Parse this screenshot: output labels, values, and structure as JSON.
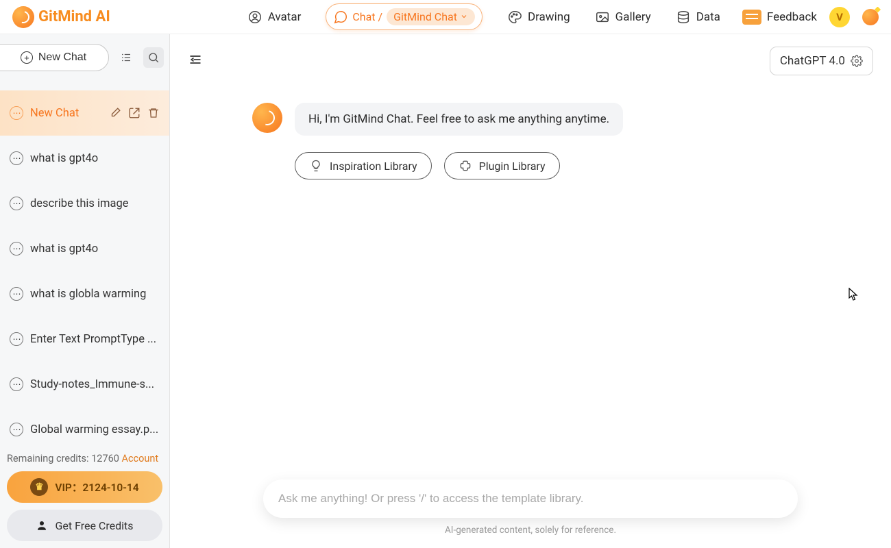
{
  "brand": "GitMind AI",
  "header": {
    "nav": {
      "avatar": "Avatar",
      "chat_prefix": "Chat /",
      "chat_sub": "GitMind Chat",
      "drawing": "Drawing",
      "gallery": "Gallery",
      "data": "Data"
    },
    "feedback": "Feedback",
    "user_initial": "V"
  },
  "sidebar": {
    "new_chat_btn": "New Chat",
    "list": [
      {
        "label": "New Chat",
        "active": true
      },
      {
        "label": "what is gpt4o"
      },
      {
        "label": "describe this image"
      },
      {
        "label": "what is gpt4o"
      },
      {
        "label": "what is globla warming"
      },
      {
        "label": "Enter Text PromptType ..."
      },
      {
        "label": "Study-notes_Immune-s..."
      },
      {
        "label": "Global warming essay.p..."
      }
    ],
    "credits_label": "Remaining credits: ",
    "credits_value": "12760",
    "account_link": "Account",
    "vip_label": "VIP：2124-10-14",
    "free_credits": "Get Free Credits"
  },
  "main": {
    "model": "ChatGPT 4.0",
    "greeting": "Hi, I'm GitMind Chat. Feel free to ask me anything anytime.",
    "chip_inspiration": "Inspiration Library",
    "chip_plugin": "Plugin Library",
    "placeholder": "Ask me anything! Or press '/' to access the template library.",
    "disclaimer": "AI-generated content, solely for reference."
  }
}
